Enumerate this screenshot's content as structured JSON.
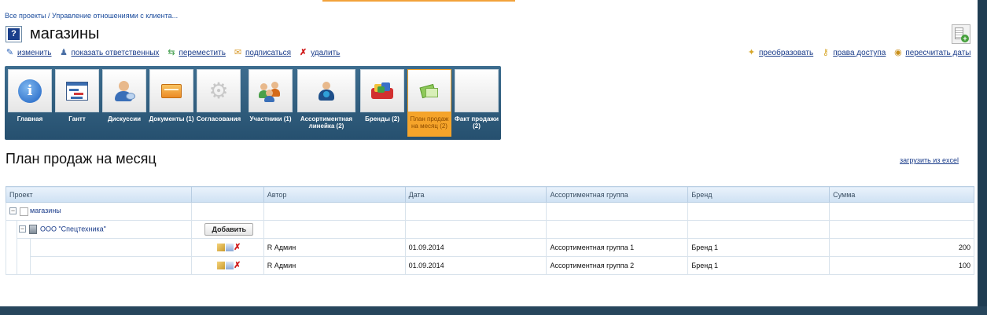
{
  "breadcrumb": "Все проекты / Управление отношениями с клиента...",
  "page": {
    "title": "магазины"
  },
  "actions_left": [
    {
      "icon": "pencil-icon",
      "label": "изменить"
    },
    {
      "icon": "person-icon",
      "label": "показать ответственных"
    },
    {
      "icon": "move-arrows-icon",
      "label": "переместить"
    },
    {
      "icon": "envelope-icon",
      "label": "подписаться"
    },
    {
      "icon": "red-x-icon",
      "label": "удалить"
    }
  ],
  "actions_right": [
    {
      "icon": "wand-icon",
      "label": "преобразовать"
    },
    {
      "icon": "key-icon",
      "label": "права доступа"
    },
    {
      "icon": "coins-icon",
      "label": "пересчитать даты"
    }
  ],
  "tabs": [
    {
      "label": "Главная",
      "icon": "info-icon"
    },
    {
      "label": "Гантт",
      "icon": "gantt-icon"
    },
    {
      "label": "Дискуссии",
      "icon": "discussion-icon"
    },
    {
      "label": "Документы (1)",
      "icon": "folder-icon"
    },
    {
      "label": "Согласования",
      "icon": "gear-icon"
    },
    {
      "label": "Участники (1)",
      "icon": "participants-icon"
    },
    {
      "label": "Ассортиментная линейка (2)",
      "icon": "assortment-icon"
    },
    {
      "label": "Бренды (2)",
      "icon": "brands-icon"
    },
    {
      "label": "План продаж на месяц (2)",
      "icon": "sales-plan-icon",
      "active": true
    },
    {
      "label": "Факт продажи (2)",
      "icon": "blank-icon"
    }
  ],
  "section": {
    "title": "План продаж на месяц",
    "excel_link": "загрузить из excel"
  },
  "table": {
    "headers": [
      "Проект",
      "",
      "Автор",
      "Дата",
      "Ассортиментная группа",
      "Бренд",
      "Сумма"
    ],
    "root_project": "магазины",
    "company": "ООО \"Спецтехника\"",
    "add_button": "Добавить",
    "rows": [
      {
        "author": "R Админ",
        "date": "01.09.2014",
        "group": "Ассортиментная группа 1",
        "brand": "Бренд 1",
        "sum": "200"
      },
      {
        "author": "R Админ",
        "date": "01.09.2014",
        "group": "Ассортиментная группа 2",
        "brand": "Бренд 1",
        "sum": "100"
      }
    ]
  },
  "colors": {
    "tab_bar": "#2f5c7c",
    "active_tab": "#f5a42a",
    "link": "#1a3c8a",
    "header_bg": "#d9e8f6"
  }
}
